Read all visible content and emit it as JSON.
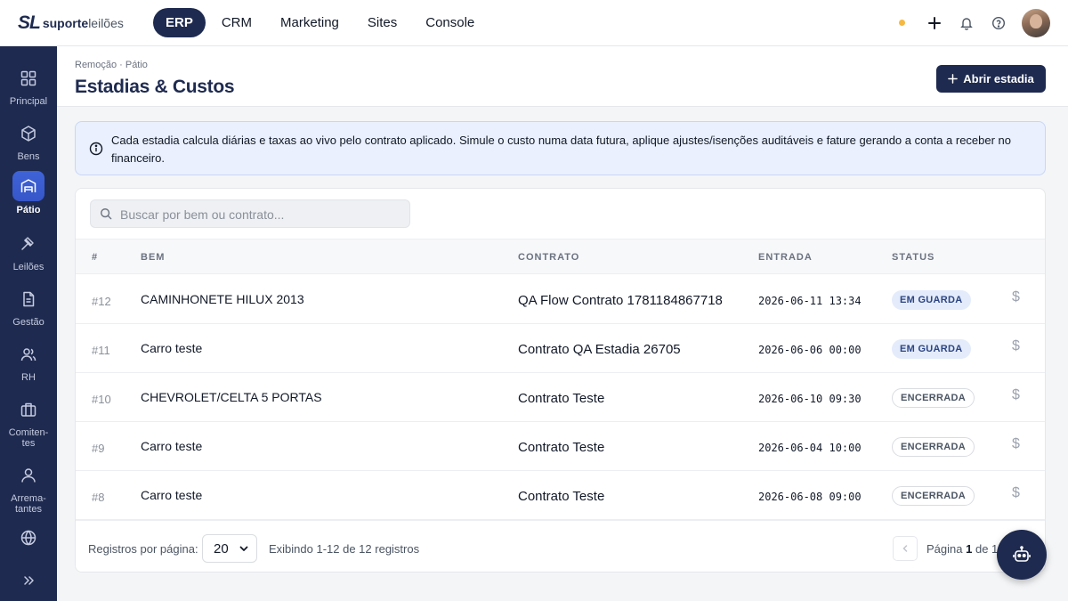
{
  "brand": {
    "mark": "SL",
    "name_bold": "suporte",
    "name_light": "leilões"
  },
  "topnav": [
    {
      "label": "ERP",
      "active": true
    },
    {
      "label": "CRM",
      "active": false
    },
    {
      "label": "Marketing",
      "active": false
    },
    {
      "label": "Sites",
      "active": false
    },
    {
      "label": "Console",
      "active": false
    }
  ],
  "top_actions": {
    "status_dot_color": "#f5b942",
    "icons": [
      "plus-icon",
      "bell-icon",
      "help-icon"
    ]
  },
  "sidebar": {
    "items": [
      {
        "label": "Principal",
        "icon": "dashboard-icon"
      },
      {
        "label": "Bens",
        "icon": "box-icon"
      },
      {
        "label": "Pátio",
        "icon": "warehouse-icon",
        "active": true
      },
      {
        "label": "Leilões",
        "icon": "gavel-icon"
      },
      {
        "label": "Gestão",
        "icon": "document-icon"
      },
      {
        "label": "RH",
        "icon": "users-icon"
      },
      {
        "label": "Comiten-\ntes",
        "icon": "briefcase-icon"
      },
      {
        "label": "Arrema-\ntantes",
        "icon": "user-icon"
      },
      {
        "label": "",
        "icon": "globe-icon"
      }
    ],
    "collapse_icon": "chevrons-right-icon"
  },
  "header": {
    "breadcrumb": "Remoção · Pátio",
    "title": "Estadias & Custos",
    "primary_button": "Abrir estadia"
  },
  "banner": {
    "text": "Cada estadia calcula diárias e taxas ao vivo pelo contrato aplicado. Simule o custo numa data futura, aplique ajustes/isenções auditáveis e fature gerando a conta a receber no financeiro."
  },
  "search": {
    "placeholder": "Buscar por bem ou contrato..."
  },
  "table": {
    "columns": [
      "#",
      "BEM",
      "CONTRATO",
      "ENTRADA",
      "STATUS"
    ],
    "rows": [
      {
        "num": "#12",
        "bem": "CAMINHONETE HILUX 2013",
        "contrato": "QA Flow Contrato 1781184867718",
        "entrada": "2026-06-11 13:34",
        "status": "EM GUARDA"
      },
      {
        "num": "#11",
        "bem": "Carro teste",
        "contrato": "Contrato QA Estadia 26705",
        "entrada": "2026-06-06 00:00",
        "status": "EM GUARDA"
      },
      {
        "num": "#10",
        "bem": "CHEVROLET/CELTA 5 PORTAS",
        "contrato": "Contrato Teste",
        "entrada": "2026-06-10 09:30",
        "status": "ENCERRADA"
      },
      {
        "num": "#9",
        "bem": "Carro teste",
        "contrato": "Contrato Teste",
        "entrada": "2026-06-04 10:00",
        "status": "ENCERRADA"
      },
      {
        "num": "#8",
        "bem": "Carro teste",
        "contrato": "Contrato Teste",
        "entrada": "2026-06-08 09:00",
        "status": "ENCERRADA"
      }
    ],
    "row_action_symbol": "$"
  },
  "pagination": {
    "rpp_label": "Registros por página:",
    "rpp_value": "20",
    "showing": "Exibindo 1-12 de 12 registros",
    "page_prefix": "Página",
    "page_current": "1",
    "page_of": "de 1"
  },
  "fab_icon": "robot-icon"
}
